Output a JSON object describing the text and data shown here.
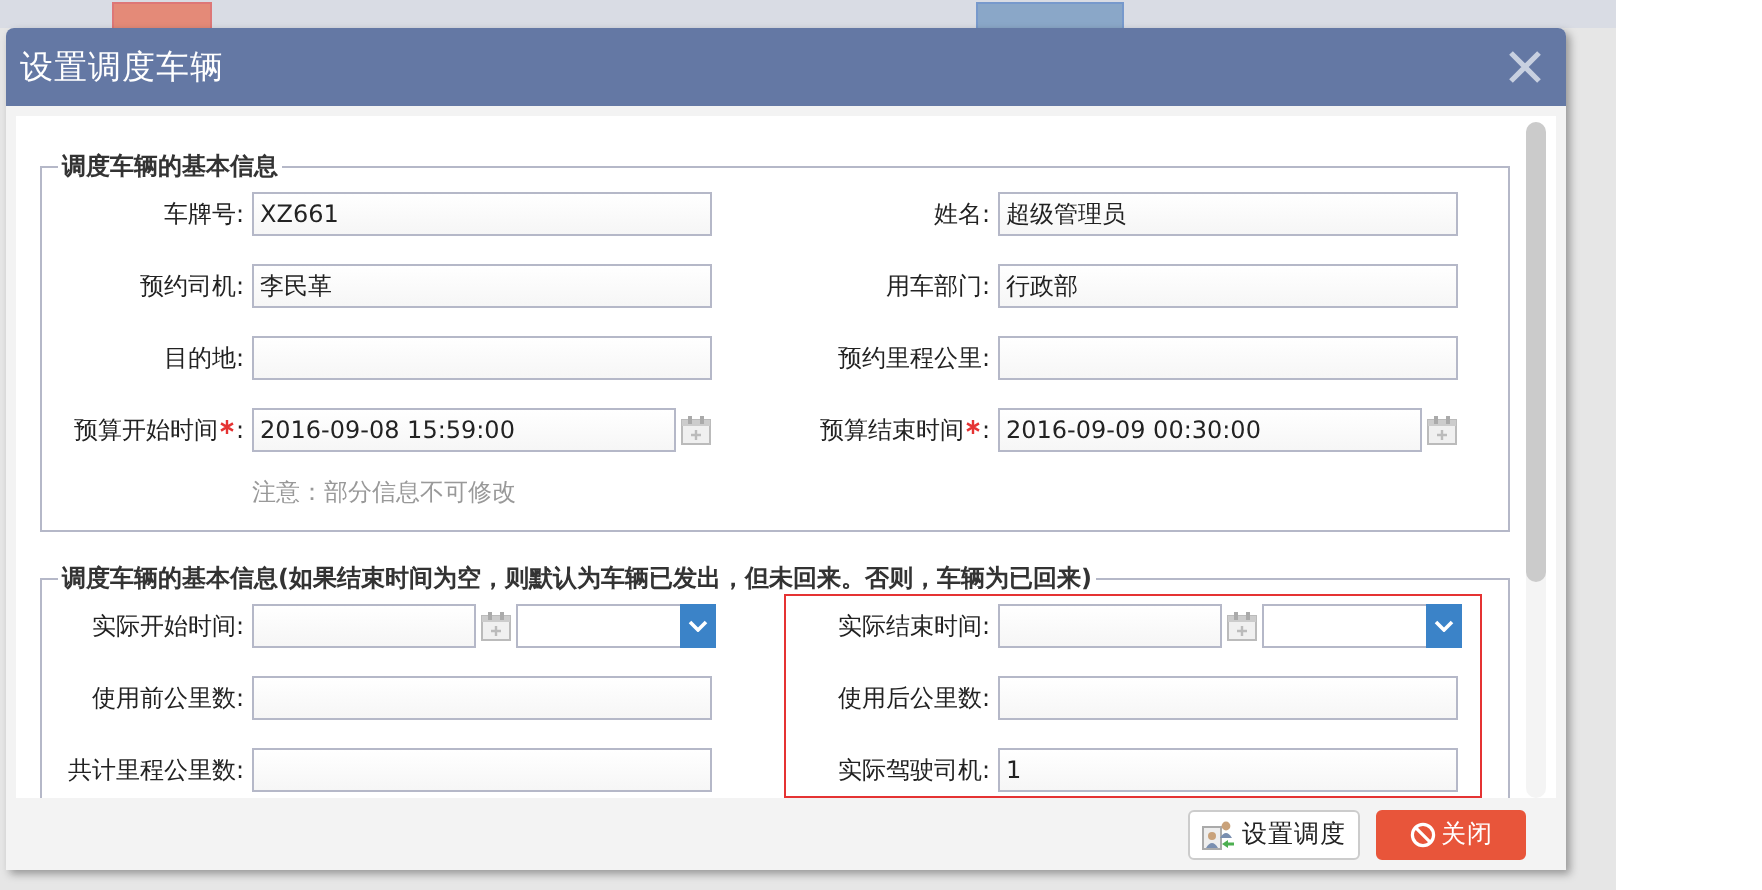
{
  "dialog": {
    "title": "设置调度车辆",
    "sections": [
      {
        "legend": "调度车辆的基本信息",
        "rows": [
          [
            {
              "kind": "text",
              "label": "车牌号:",
              "required": false,
              "value": "XZ661"
            },
            {
              "kind": "text",
              "label": "姓名:",
              "required": false,
              "value": "超级管理员"
            }
          ],
          [
            {
              "kind": "text",
              "label": "预约司机:",
              "required": false,
              "value": "李民革"
            },
            {
              "kind": "text",
              "label": "用车部门:",
              "required": false,
              "value": "行政部"
            }
          ],
          [
            {
              "kind": "text",
              "label": "目的地:",
              "required": false
            },
            {
              "kind": "text",
              "label": "预约里程公里:",
              "required": false
            }
          ],
          [
            {
              "kind": "datetime",
              "label": "预算开始时间",
              "required": true,
              "label_colon": ":",
              "value": "2016-09-08 15:59:00"
            },
            {
              "kind": "datetime",
              "label": "预算结束时间",
              "required": true,
              "label_colon": ":",
              "value": "2016-09-09 00:30:00"
            }
          ]
        ],
        "note": "注意：部分信息不可修改"
      },
      {
        "legend": "调度车辆的基本信息(如果结束时间为空，则默认为车辆已发出，但未回来。否则，车辆为已回来)",
        "rows": [
          [
            {
              "kind": "datetime-select",
              "label": "实际开始时间:",
              "required": false
            },
            {
              "kind": "datetime-select",
              "label": "实际结束时间:",
              "required": false
            }
          ],
          [
            {
              "kind": "text",
              "label": "使用前公里数:",
              "required": false
            },
            {
              "kind": "text",
              "label": "使用后公里数:",
              "required": false
            }
          ],
          [
            {
              "kind": "text",
              "label": "共计里程公里数:",
              "required": false
            },
            {
              "kind": "text",
              "label": "实际驾驶司机:",
              "required": false,
              "value": "1"
            }
          ]
        ]
      }
    ],
    "buttons": [
      {
        "label": "设置调度",
        "kind": "secondary"
      },
      {
        "label": "关闭",
        "kind": "danger"
      }
    ]
  }
}
